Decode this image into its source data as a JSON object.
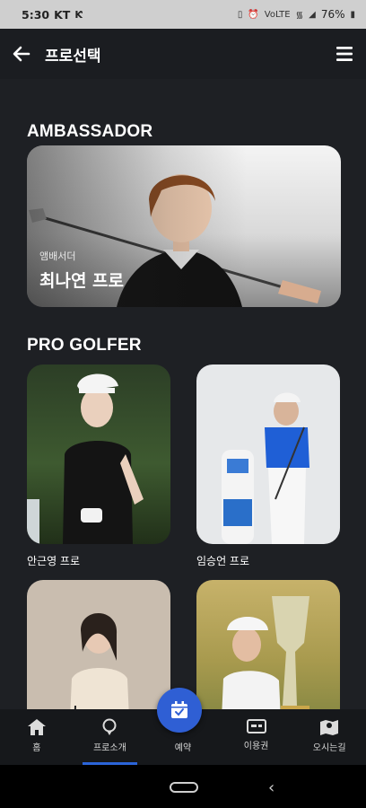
{
  "status_bar": {
    "time": "5:30",
    "carrier": "KT",
    "battery": "76%"
  },
  "header": {
    "title": "프로선택"
  },
  "ambassador": {
    "section_title": "AMBASSADOR",
    "subtitle": "앰배서더",
    "name": "최나연 프로"
  },
  "pro_golfer": {
    "section_title": "PRO GOLFER",
    "pros": [
      {
        "name": "안근영 프로"
      },
      {
        "name": "임승언 프로"
      },
      {
        "name": ""
      },
      {
        "name": ""
      }
    ]
  },
  "bottom_nav": {
    "items": [
      {
        "label": "홈",
        "icon": "home-icon"
      },
      {
        "label": "프로소개",
        "icon": "pro-intro-icon",
        "active": true
      },
      {
        "label": "예약",
        "icon": "calendar-icon"
      },
      {
        "label": "이용권",
        "icon": "ticket-icon"
      },
      {
        "label": "오시는길",
        "icon": "map-icon"
      }
    ]
  },
  "colors": {
    "accent": "#2f5fd4",
    "background": "#1e2024",
    "header": "#1b1d21"
  }
}
